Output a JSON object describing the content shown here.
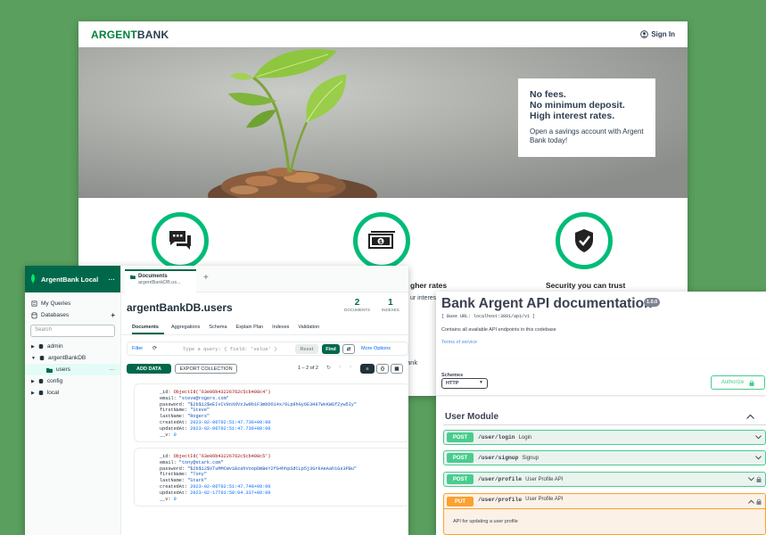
{
  "bank": {
    "logo_part1": "ARGENT",
    "logo_part2": "BANK",
    "signin": "Sign In",
    "promo": {
      "subtitles": [
        "No fees.",
        "No minimum deposit.",
        "High interest rates."
      ],
      "text": "Open a savings account with Argent Bank today!"
    },
    "features": [
      {
        "icon": "chat-icon",
        "title": "",
        "desc": ""
      },
      {
        "icon": "money-icon",
        "title": "gher rates",
        "desc": "ur interest"
      },
      {
        "icon": "shield-icon",
        "title": "Security you can trust",
        "desc": ""
      }
    ],
    "behind_text": "ank",
    "accent": "#00bc77"
  },
  "compass": {
    "app_name": "ArgentBank Local",
    "tab": {
      "label": "Documents",
      "ns": "argentBankDB.us..."
    },
    "sidebar": {
      "my_queries": "My Queries",
      "databases": "Databases",
      "search_placeholder": "Search",
      "dbs": [
        "admin",
        "argentBankDB",
        "users",
        "config",
        "local"
      ]
    },
    "collection": "argentBankDB.users",
    "stats": {
      "documents": "2",
      "documents_label": "DOCUMENTS",
      "indexes": "1",
      "indexes_label": "INDEXES"
    },
    "subtabs": [
      "Documents",
      "Aggregations",
      "Schema",
      "Explain Plan",
      "Indexes",
      "Validation"
    ],
    "filter_label": "Filter",
    "query_placeholder": "Type a query: { field: 'value' }",
    "reset": "Reset",
    "find": "Find",
    "more_options": "More Options",
    "add_data": "ADD DATA",
    "export": "EXPORT COLLECTION",
    "pagination": "1 – 2 of 2",
    "docs": [
      {
        "id": "ObjectId('63e06b43226762c5cb408c4')",
        "email": "\"steve@rogers.com\"",
        "password": "\"$2b$12$eEIvCV8nXdVxJw9b1F3mbDO14x/0Lp8hGy6E3H97WxKWGfZyw5Iy\"",
        "firstName": "\"Steve\"",
        "lastName": "\"Rogers\"",
        "createdAt": "2023-02-06T02:51:47.736+00:00",
        "updatedAt": "2023-02-06T02:51:47.736+00:00",
        "v": "0"
      },
      {
        "id": "ObjectId('63e06b43226762c5cb408c5')",
        "email": "\"tony@stark.com\"",
        "password": "\"$2b$12$VTuMMCWv1BzahVoopDmBeY2fG4hhpSdCLp5j3GrkAeAah1Gs3PBu\"",
        "firstName": "\"Tony\"",
        "lastName": "\"Stark\"",
        "createdAt": "2023-02-06T02:51:47.748+00:00",
        "updatedAt": "2023-02-17T01:58:04.337+00:00",
        "v": "0"
      }
    ]
  },
  "swagger": {
    "title": "Bank Argent API documentation",
    "version": "1.0.0",
    "base_url": "[ Base URL: localhost:3001/api/v1 ]",
    "description": "Contains all available API endpoints in this codebase",
    "terms": "Terms of service",
    "schemes_label": "Schemes",
    "scheme": "HTTP",
    "authorize": "Authorize",
    "section": "User Module",
    "ops": [
      {
        "method": "POST",
        "path": "/user/login",
        "summary": "Login"
      },
      {
        "method": "POST",
        "path": "/user/signup",
        "summary": "Signup"
      },
      {
        "method": "POST",
        "path": "/user/profile",
        "summary": "User Profile API"
      },
      {
        "method": "PUT",
        "path": "/user/profile",
        "summary": "User Profile API"
      }
    ],
    "put_desc": "API for updating a user profile"
  }
}
